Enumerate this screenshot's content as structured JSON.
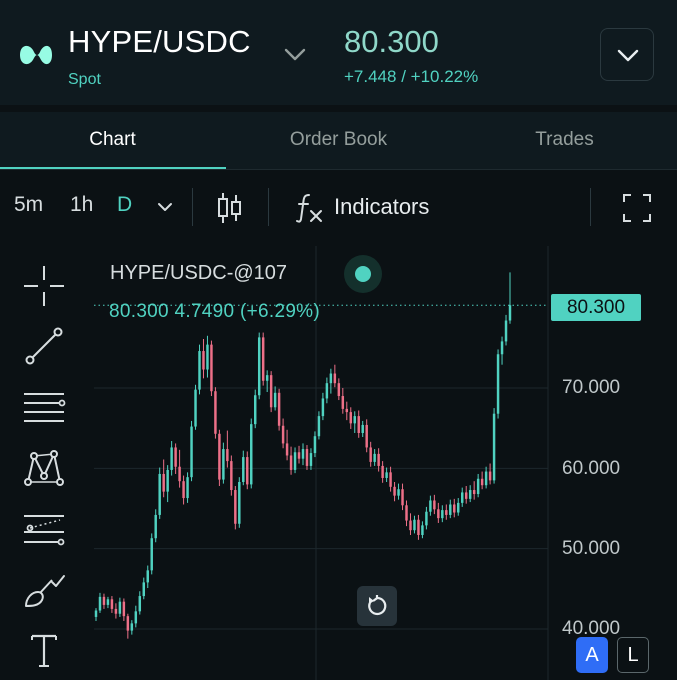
{
  "header": {
    "pair": "HYPE/USDC",
    "market_type": "Spot",
    "price": "80.300",
    "change": "+7.448 / +10.22%"
  },
  "tabs": [
    {
      "label": "Chart",
      "active": true
    },
    {
      "label": "Order Book",
      "active": false
    },
    {
      "label": "Trades",
      "active": false
    }
  ],
  "toolbar": {
    "timeframes": [
      "5m",
      "1h",
      "D"
    ],
    "selected_timeframe": "D",
    "indicators_label": "Indicators"
  },
  "legend": {
    "title": "HYPE/USDC-@107",
    "values": "80.300  4.7490 (+6.29%)"
  },
  "price_axis": {
    "ticks": [
      "70.000",
      "60.000",
      "50.000",
      "40.000"
    ],
    "current_price_tag": "80.300"
  },
  "scale_buttons": {
    "auto": "A",
    "log": "L"
  },
  "colors": {
    "accent": "#50d2c1",
    "bearish": "#ed7088",
    "background": "#0b1114",
    "panel": "#0f1a1f"
  },
  "chart_data": {
    "type": "candlestick",
    "timeframe": "D",
    "ylim": [
      39,
      87
    ],
    "candles": [
      [
        41.5,
        42.6,
        41.0,
        42.3
      ],
      [
        42.3,
        44.5,
        42.0,
        44.0
      ],
      [
        44.0,
        44.4,
        42.5,
        43.0
      ],
      [
        43.0,
        44.0,
        42.6,
        43.7
      ],
      [
        43.7,
        44.1,
        42.0,
        42.5
      ],
      [
        42.5,
        43.2,
        41.3,
        41.9
      ],
      [
        41.9,
        43.9,
        41.5,
        43.4
      ],
      [
        43.4,
        43.8,
        41.0,
        41.6
      ],
      [
        41.6,
        41.9,
        38.8,
        39.8
      ],
      [
        39.8,
        41.1,
        39.3,
        40.7
      ],
      [
        40.7,
        42.9,
        40.2,
        42.2
      ],
      [
        42.2,
        44.7,
        41.8,
        44.1
      ],
      [
        44.1,
        46.4,
        43.7,
        45.8
      ],
      [
        45.8,
        47.9,
        45.1,
        47.3
      ],
      [
        47.3,
        51.9,
        46.8,
        51.3
      ],
      [
        51.3,
        54.9,
        50.8,
        54.2
      ],
      [
        54.2,
        60.1,
        53.7,
        59.3
      ],
      [
        59.3,
        61.1,
        56.4,
        57.1
      ],
      [
        57.1,
        60.4,
        55.8,
        59.8
      ],
      [
        59.8,
        63.4,
        59.1,
        62.6
      ],
      [
        62.6,
        63.1,
        59.3,
        60.2
      ],
      [
        60.2,
        62.3,
        57.6,
        58.4
      ],
      [
        58.4,
        59.1,
        55.5,
        56.3
      ],
      [
        56.3,
        59.5,
        55.7,
        58.9
      ],
      [
        58.9,
        65.9,
        58.4,
        65.2
      ],
      [
        65.2,
        70.4,
        64.8,
        69.8
      ],
      [
        69.8,
        75.4,
        69.2,
        74.6
      ],
      [
        74.6,
        76.1,
        71.2,
        72.3
      ],
      [
        72.3,
        76.5,
        71.3,
        75.4
      ],
      [
        75.4,
        75.9,
        69.0,
        69.6
      ],
      [
        69.6,
        70.1,
        63.7,
        64.3
      ],
      [
        64.3,
        64.8,
        57.8,
        58.6
      ],
      [
        58.6,
        63.2,
        58.1,
        62.4
      ],
      [
        62.4,
        64.7,
        60.1,
        60.9
      ],
      [
        60.9,
        61.6,
        56.6,
        57.3
      ],
      [
        57.3,
        57.8,
        52.4,
        53.1
      ],
      [
        53.1,
        58.9,
        52.6,
        58.3
      ],
      [
        58.3,
        62.2,
        57.9,
        61.4
      ],
      [
        61.4,
        62.1,
        57.4,
        58.0
      ],
      [
        58.0,
        66.2,
        57.5,
        65.5
      ],
      [
        65.5,
        69.8,
        65.0,
        69.1
      ],
      [
        69.1,
        76.9,
        68.6,
        76.3
      ],
      [
        76.3,
        76.9,
        70.3,
        70.9
      ],
      [
        70.9,
        72.2,
        69.5,
        71.6
      ],
      [
        71.6,
        72.1,
        67.0,
        67.6
      ],
      [
        67.6,
        70.2,
        67.2,
        69.4
      ],
      [
        69.4,
        69.9,
        64.7,
        65.3
      ],
      [
        65.3,
        66.2,
        62.5,
        63.1
      ],
      [
        63.1,
        64.8,
        61.0,
        61.6
      ],
      [
        61.6,
        62.7,
        59.2,
        59.8
      ],
      [
        59.8,
        62.6,
        59.4,
        62.0
      ],
      [
        62.0,
        62.8,
        60.6,
        61.2
      ],
      [
        61.2,
        63.1,
        60.4,
        62.4
      ],
      [
        62.4,
        62.9,
        59.8,
        60.3
      ],
      [
        60.3,
        62.5,
        59.8,
        61.9
      ],
      [
        61.9,
        64.6,
        61.4,
        64.0
      ],
      [
        64.0,
        67.1,
        63.6,
        66.5
      ],
      [
        66.5,
        69.4,
        66.0,
        68.7
      ],
      [
        68.7,
        71.3,
        68.1,
        70.6
      ],
      [
        70.6,
        72.4,
        69.3,
        71.8
      ],
      [
        71.8,
        72.9,
        70.1,
        70.6
      ],
      [
        70.6,
        71.2,
        68.5,
        69.0
      ],
      [
        69.0,
        70.0,
        66.8,
        67.4
      ],
      [
        67.4,
        68.3,
        66.0,
        67.0
      ],
      [
        67.0,
        67.6,
        64.9,
        65.6
      ],
      [
        65.6,
        67.1,
        64.4,
        66.5
      ],
      [
        66.5,
        67.2,
        63.8,
        64.4
      ],
      [
        64.4,
        65.9,
        63.9,
        65.4
      ],
      [
        65.4,
        66.1,
        62.0,
        62.6
      ],
      [
        62.6,
        63.3,
        60.2,
        60.8
      ],
      [
        60.8,
        62.4,
        60.3,
        61.8
      ],
      [
        61.8,
        62.5,
        59.6,
        60.3
      ],
      [
        60.3,
        60.9,
        58.2,
        58.8
      ],
      [
        58.8,
        60.1,
        58.3,
        59.5
      ],
      [
        59.5,
        60.2,
        57.1,
        57.7
      ],
      [
        57.7,
        58.3,
        55.9,
        56.6
      ],
      [
        56.6,
        58.1,
        56.1,
        57.4
      ],
      [
        57.4,
        58.1,
        54.8,
        55.4
      ],
      [
        55.4,
        56.0,
        52.8,
        53.5
      ],
      [
        53.5,
        54.4,
        51.7,
        52.3
      ],
      [
        52.3,
        54.1,
        51.9,
        53.6
      ],
      [
        53.6,
        54.2,
        51.1,
        51.7
      ],
      [
        51.7,
        53.4,
        51.3,
        52.9
      ],
      [
        52.9,
        55.2,
        52.4,
        54.6
      ],
      [
        54.6,
        56.6,
        54.1,
        56.0
      ],
      [
        56.0,
        56.7,
        54.3,
        54.9
      ],
      [
        54.9,
        55.7,
        53.2,
        53.8
      ],
      [
        53.8,
        55.4,
        53.3,
        54.8
      ],
      [
        54.8,
        55.5,
        53.6,
        54.2
      ],
      [
        54.2,
        56.1,
        53.8,
        55.5
      ],
      [
        55.5,
        56.2,
        53.9,
        54.5
      ],
      [
        54.5,
        56.3,
        54.1,
        55.7
      ],
      [
        55.7,
        57.6,
        55.2,
        57.0
      ],
      [
        57.0,
        57.8,
        55.6,
        56.2
      ],
      [
        56.2,
        57.9,
        55.8,
        57.3
      ],
      [
        57.3,
        58.4,
        56.1,
        56.8
      ],
      [
        56.8,
        59.3,
        56.4,
        58.7
      ],
      [
        58.7,
        59.6,
        57.4,
        57.9
      ],
      [
        57.9,
        60.2,
        57.5,
        59.6
      ],
      [
        59.6,
        60.6,
        58.0,
        58.5
      ],
      [
        58.5,
        67.5,
        58.1,
        66.8
      ],
      [
        66.8,
        74.8,
        66.2,
        74.2
      ],
      [
        74.2,
        76.4,
        72.9,
        75.8
      ],
      [
        75.8,
        79.1,
        75.3,
        78.4
      ],
      [
        78.4,
        84.4,
        78.0,
        80.3
      ]
    ]
  }
}
